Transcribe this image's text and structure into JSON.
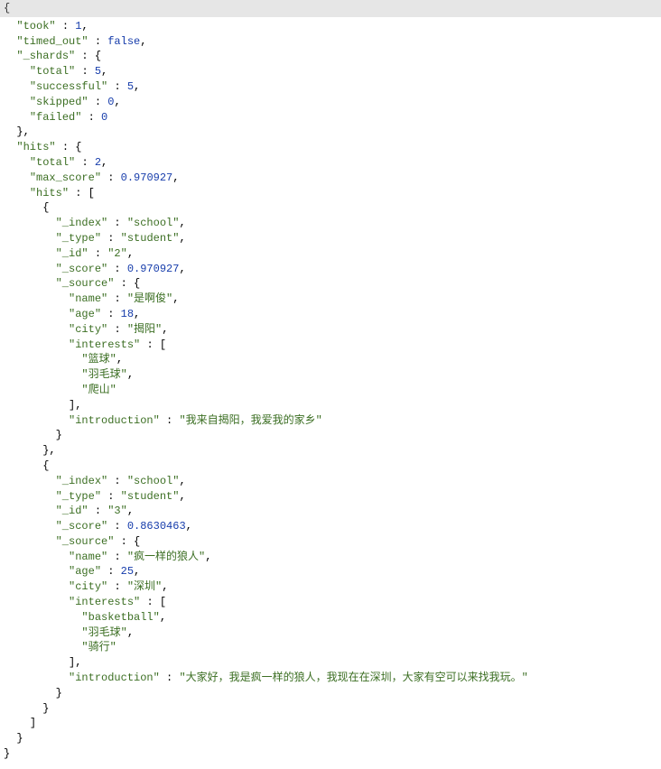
{
  "header_brace": "{",
  "took_key": "\"took\"",
  "took_val": "1",
  "timed_out_key": "\"timed_out\"",
  "timed_out_val": "false",
  "shards_key": "\"_shards\"",
  "shards_total_key": "\"total\"",
  "shards_total_val": "5",
  "shards_successful_key": "\"successful\"",
  "shards_successful_val": "5",
  "shards_skipped_key": "\"skipped\"",
  "shards_skipped_val": "0",
  "shards_failed_key": "\"failed\"",
  "shards_failed_val": "0",
  "hits_key": "\"hits\"",
  "hits_total_key": "\"total\"",
  "hits_total_val": "2",
  "max_score_key": "\"max_score\"",
  "max_score_val": "0.970927",
  "hits_arr_key": "\"hits\"",
  "h0_index_key": "\"_index\"",
  "h0_index_val": "\"school\"",
  "h0_type_key": "\"_type\"",
  "h0_type_val": "\"student\"",
  "h0_id_key": "\"_id\"",
  "h0_id_val": "\"2\"",
  "h0_score_key": "\"_score\"",
  "h0_score_val": "0.970927",
  "h0_source_key": "\"_source\"",
  "h0_name_key": "\"name\"",
  "h0_name_val": "\"是啊俊\"",
  "h0_age_key": "\"age\"",
  "h0_age_val": "18",
  "h0_city_key": "\"city\"",
  "h0_city_val": "\"揭阳\"",
  "h0_interests_key": "\"interests\"",
  "h0_int0": "\"篮球\"",
  "h0_int1": "\"羽毛球\"",
  "h0_int2": "\"爬山\"",
  "h0_intro_key": "\"introduction\"",
  "h0_intro_val": "\"我来自揭阳，我爱我的家乡\"",
  "h1_index_key": "\"_index\"",
  "h1_index_val": "\"school\"",
  "h1_type_key": "\"_type\"",
  "h1_type_val": "\"student\"",
  "h1_id_key": "\"_id\"",
  "h1_id_val": "\"3\"",
  "h1_score_key": "\"_score\"",
  "h1_score_val": "0.8630463",
  "h1_source_key": "\"_source\"",
  "h1_name_key": "\"name\"",
  "h1_name_val": "\"疯一样的狼人\"",
  "h1_age_key": "\"age\"",
  "h1_age_val": "25",
  "h1_city_key": "\"city\"",
  "h1_city_val": "\"深圳\"",
  "h1_interests_key": "\"interests\"",
  "h1_int0": "\"basketball\"",
  "h1_int1": "\"羽毛球\"",
  "h1_int2": "\"骑行\"",
  "h1_intro_key": "\"introduction\"",
  "h1_intro_val": "\"大家好，我是疯一样的狼人，我现在在深圳，大家有空可以来找我玩。\""
}
